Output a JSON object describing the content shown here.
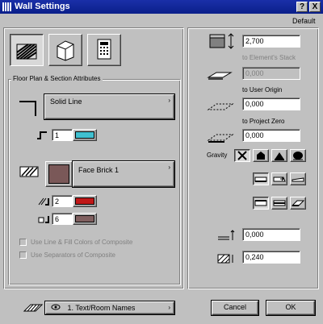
{
  "window": {
    "title": "Wall Settings",
    "help_label": "?",
    "close_label": "X"
  },
  "menu": {
    "default_label": "Default"
  },
  "left_panel": {
    "section_title": "Floor Plan & Section Attributes",
    "line_type": "Solid Line",
    "line_pen": "1",
    "fill_type": "Face Brick 1",
    "fill_pen": "2",
    "fill_bg_pen": "6",
    "option_use_line_fill": "Use Line & Fill Colors of Composite",
    "option_use_separators": "Use Separators of Composite"
  },
  "right_panel": {
    "height_value": "2,700",
    "label_elevation": "to Element's Stack",
    "elevation_value": "0,000",
    "label_user_origin": "to User Origin",
    "user_origin_value": "0,000",
    "label_project_zero": "to Project Zero",
    "project_zero_value": "0,000",
    "gravity_label": "Gravity",
    "offset_value": "0,000",
    "thickness_value": "0,240"
  },
  "footer": {
    "layer_value": "1. Text/Room Names",
    "cancel_label": "Cancel",
    "ok_label": "OK"
  },
  "colors": {
    "title_bar": "#1a2fa8",
    "pen1_swatch": "#40c0d0",
    "fill_swatch": "#7a5858",
    "pen2_swatch": "#c01818",
    "pen6_swatch": "#806060"
  }
}
